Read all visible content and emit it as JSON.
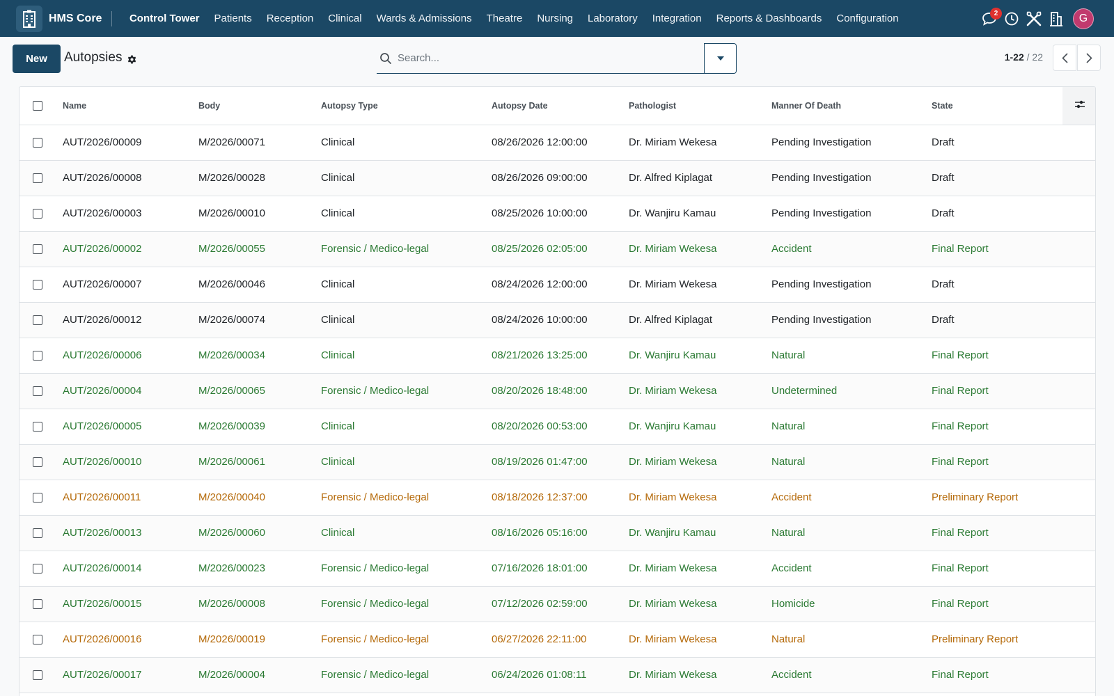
{
  "navbar": {
    "brand": "HMS Core",
    "menu": [
      "Control Tower",
      "Patients",
      "Reception",
      "Clinical",
      "Wards & Admissions",
      "Theatre",
      "Nursing",
      "Laboratory",
      "Integration",
      "Reports & Dashboards",
      "Configuration"
    ],
    "message_count": "2",
    "avatar_letter": "G",
    "icons": [
      "hospital-building-icon",
      "chat-icon",
      "clock-icon",
      "tools-icon",
      "company-icon"
    ]
  },
  "control": {
    "new_label": "New",
    "title": "Autopsies",
    "search_placeholder": "Search...",
    "pager_range": "1-22",
    "pager_total": "22"
  },
  "colors": {
    "navbar": "#1b4865",
    "draft": "#212529",
    "final_report": "#2b7a33",
    "preliminary_report": "#b56a0a"
  },
  "table": {
    "headers": [
      "Name",
      "Body",
      "Autopsy Type",
      "Autopsy Date",
      "Pathologist",
      "Manner Of Death",
      "State"
    ],
    "rows": [
      {
        "name": "AUT/2026/00009",
        "body": "M/2026/00071",
        "type": "Clinical",
        "date": "08/26/2026 12:00:00",
        "pathologist": "Dr. Miriam Wekesa",
        "manner": "Pending Investigation",
        "state": "Draft",
        "status": "draft"
      },
      {
        "name": "AUT/2026/00008",
        "body": "M/2026/00028",
        "type": "Clinical",
        "date": "08/26/2026 09:00:00",
        "pathologist": "Dr. Alfred Kiplagat",
        "manner": "Pending Investigation",
        "state": "Draft",
        "status": "draft"
      },
      {
        "name": "AUT/2026/00003",
        "body": "M/2026/00010",
        "type": "Clinical",
        "date": "08/25/2026 10:00:00",
        "pathologist": "Dr. Wanjiru Kamau",
        "manner": "Pending Investigation",
        "state": "Draft",
        "status": "draft"
      },
      {
        "name": "AUT/2026/00002",
        "body": "M/2026/00055",
        "type": "Forensic / Medico-legal",
        "date": "08/25/2026 02:05:00",
        "pathologist": "Dr. Miriam Wekesa",
        "manner": "Accident",
        "state": "Final Report",
        "status": "final"
      },
      {
        "name": "AUT/2026/00007",
        "body": "M/2026/00046",
        "type": "Clinical",
        "date": "08/24/2026 12:00:00",
        "pathologist": "Dr. Miriam Wekesa",
        "manner": "Pending Investigation",
        "state": "Draft",
        "status": "draft"
      },
      {
        "name": "AUT/2026/00012",
        "body": "M/2026/00074",
        "type": "Clinical",
        "date": "08/24/2026 10:00:00",
        "pathologist": "Dr. Alfred Kiplagat",
        "manner": "Pending Investigation",
        "state": "Draft",
        "status": "draft"
      },
      {
        "name": "AUT/2026/00006",
        "body": "M/2026/00034",
        "type": "Clinical",
        "date": "08/21/2026 13:25:00",
        "pathologist": "Dr. Wanjiru Kamau",
        "manner": "Natural",
        "state": "Final Report",
        "status": "final"
      },
      {
        "name": "AUT/2026/00004",
        "body": "M/2026/00065",
        "type": "Forensic / Medico-legal",
        "date": "08/20/2026 18:48:00",
        "pathologist": "Dr. Miriam Wekesa",
        "manner": "Undetermined",
        "state": "Final Report",
        "status": "final"
      },
      {
        "name": "AUT/2026/00005",
        "body": "M/2026/00039",
        "type": "Clinical",
        "date": "08/20/2026 00:53:00",
        "pathologist": "Dr. Wanjiru Kamau",
        "manner": "Natural",
        "state": "Final Report",
        "status": "final"
      },
      {
        "name": "AUT/2026/00010",
        "body": "M/2026/00061",
        "type": "Clinical",
        "date": "08/19/2026 01:47:00",
        "pathologist": "Dr. Miriam Wekesa",
        "manner": "Natural",
        "state": "Final Report",
        "status": "final"
      },
      {
        "name": "AUT/2026/00011",
        "body": "M/2026/00040",
        "type": "Forensic / Medico-legal",
        "date": "08/18/2026 12:37:00",
        "pathologist": "Dr. Miriam Wekesa",
        "manner": "Accident",
        "state": "Preliminary Report",
        "status": "prelim"
      },
      {
        "name": "AUT/2026/00013",
        "body": "M/2026/00060",
        "type": "Clinical",
        "date": "08/16/2026 05:16:00",
        "pathologist": "Dr. Wanjiru Kamau",
        "manner": "Natural",
        "state": "Final Report",
        "status": "final"
      },
      {
        "name": "AUT/2026/00014",
        "body": "M/2026/00023",
        "type": "Forensic / Medico-legal",
        "date": "07/16/2026 18:01:00",
        "pathologist": "Dr. Miriam Wekesa",
        "manner": "Accident",
        "state": "Final Report",
        "status": "final"
      },
      {
        "name": "AUT/2026/00015",
        "body": "M/2026/00008",
        "type": "Forensic / Medico-legal",
        "date": "07/12/2026 02:59:00",
        "pathologist": "Dr. Miriam Wekesa",
        "manner": "Homicide",
        "state": "Final Report",
        "status": "final"
      },
      {
        "name": "AUT/2026/00016",
        "body": "M/2026/00019",
        "type": "Forensic / Medico-legal",
        "date": "06/27/2026 22:11:00",
        "pathologist": "Dr. Miriam Wekesa",
        "manner": "Natural",
        "state": "Preliminary Report",
        "status": "prelim"
      },
      {
        "name": "AUT/2026/00017",
        "body": "M/2026/00004",
        "type": "Forensic / Medico-legal",
        "date": "06/24/2026 01:08:11",
        "pathologist": "Dr. Miriam Wekesa",
        "manner": "Accident",
        "state": "Final Report",
        "status": "final"
      }
    ]
  }
}
